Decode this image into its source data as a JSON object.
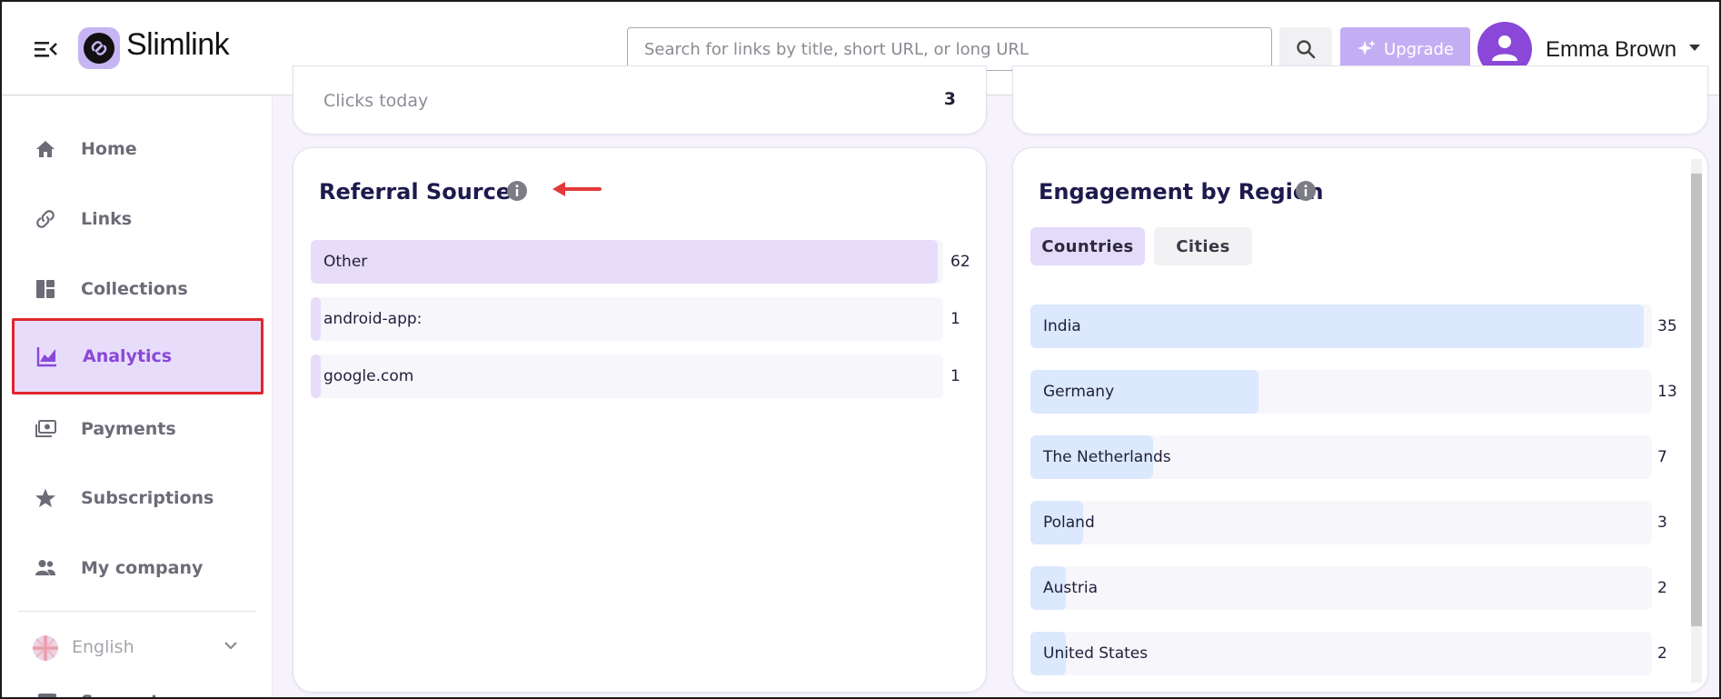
{
  "app": {
    "name": "Slimlink"
  },
  "header": {
    "search_placeholder": "Search for links by title, short URL, or long URL",
    "upgrade_label": "Upgrade",
    "user_name": "Emma Brown"
  },
  "sidebar": {
    "items": [
      {
        "label": "Home",
        "icon": "home-icon"
      },
      {
        "label": "Links",
        "icon": "link-icon"
      },
      {
        "label": "Collections",
        "icon": "collections-icon"
      },
      {
        "label": "Analytics",
        "icon": "analytics-icon",
        "active": true
      },
      {
        "label": "Payments",
        "icon": "payments-icon"
      },
      {
        "label": "Subscriptions",
        "icon": "star-icon"
      },
      {
        "label": "My company",
        "icon": "company-icon"
      }
    ],
    "language": "English",
    "support_label": "Support"
  },
  "stats": {
    "clicks_today_label": "Clicks today",
    "clicks_today_value": "3"
  },
  "referral": {
    "title": "Referral Sources",
    "rows": [
      {
        "label": "Other",
        "value": 62
      },
      {
        "label": "android-app:",
        "value": 1
      },
      {
        "label": "google.com",
        "value": 1
      }
    ]
  },
  "region": {
    "title": "Engagement by Region",
    "tabs": [
      {
        "label": "Countries",
        "active": true
      },
      {
        "label": "Cities",
        "active": false
      }
    ],
    "rows": [
      {
        "label": "India",
        "value": 35
      },
      {
        "label": "Germany",
        "value": 13
      },
      {
        "label": "The Netherlands",
        "value": 7
      },
      {
        "label": "Poland",
        "value": 3
      },
      {
        "label": "Austria",
        "value": 2
      },
      {
        "label": "United States",
        "value": 2
      }
    ]
  },
  "colors": {
    "brand": "#8a47d8",
    "referral_bar": "#e7ddfa",
    "region_bar": "#dbe8fd",
    "highlight_border": "#e0262c"
  }
}
